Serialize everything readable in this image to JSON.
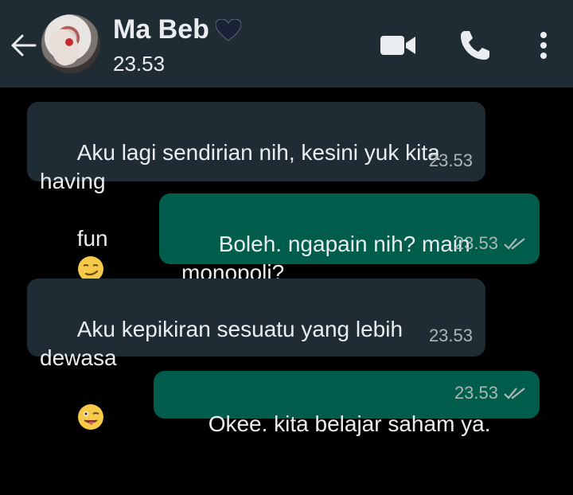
{
  "header": {
    "contact_name": "Ma Beb",
    "status": "23.53",
    "icons": [
      "back-arrow-icon",
      "avatar",
      "black-heart-icon",
      "video-call-icon",
      "phone-call-icon",
      "more-options-icon"
    ],
    "background": "#1f2c34"
  },
  "messages": [
    {
      "direction": "incoming",
      "text_line1": "Aku lagi sendirian nih, kesini yuk kita having",
      "text_line2": "fun",
      "emoji": "smirk-emoji-icon",
      "time": "23.53"
    },
    {
      "direction": "outgoing",
      "text": "Boleh. ngapain nih? main monopoli?",
      "time": "23.53",
      "status_icon": "double-tick-icon"
    },
    {
      "direction": "incoming",
      "text": "Aku kepikiran sesuatu yang lebih dewasa",
      "emoji": "tongue-wink-emoji-icon",
      "time": "23.53"
    },
    {
      "direction": "outgoing",
      "text": "Okee. kita belajar saham ya.",
      "time": "23.53",
      "status_icon": "double-tick-icon"
    }
  ],
  "colors": {
    "incoming_bubble": "#1f2c34",
    "outgoing_bubble": "#005c4b",
    "chat_background": "#000000"
  }
}
